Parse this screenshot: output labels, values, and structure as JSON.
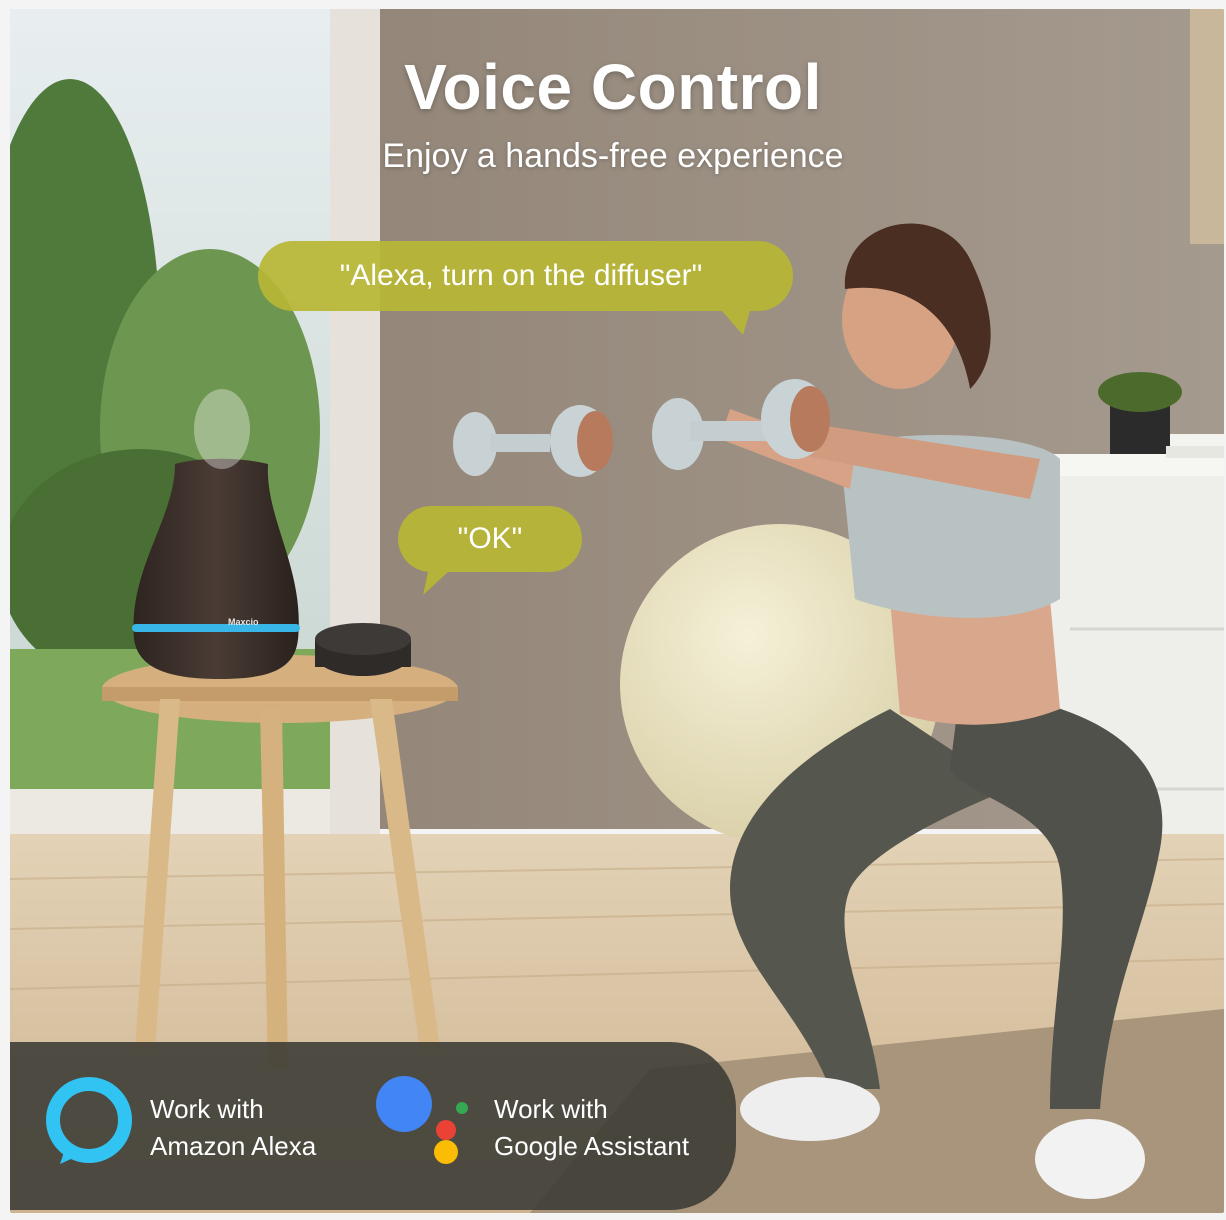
{
  "headline": {
    "title": "Voice Control",
    "subtitle": "Enjoy a hands-free experience"
  },
  "speech_bubbles": {
    "command": "\"Alexa, turn on the diffuser\"",
    "reply": "\"OK\""
  },
  "product": {
    "brand_label": "Maxcio"
  },
  "badges": {
    "alexa": {
      "line1": "Work with",
      "line2": "Amazon Alexa",
      "icon": "amazon-alexa-logo"
    },
    "google": {
      "line1": "Work with",
      "line2": "Google Assistant",
      "icon": "google-assistant-logo"
    }
  },
  "colors": {
    "bubble": "#b7b634",
    "alexa_blue": "#31c4f3",
    "google_blue": "#4285f4",
    "google_red": "#ea4335",
    "google_yellow": "#fbbc05",
    "google_green": "#34a853",
    "badge_bar": "#3a3a34"
  }
}
